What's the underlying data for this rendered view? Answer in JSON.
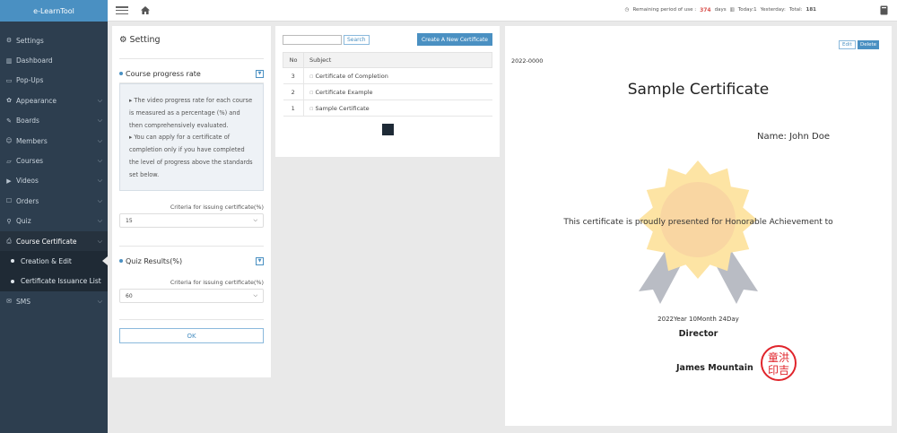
{
  "brand": "e-LearnTool",
  "menu": [
    {
      "icon": "⚙",
      "label": "Settings",
      "chevron": false
    },
    {
      "icon": "▥",
      "label": "Dashboard",
      "chevron": false
    },
    {
      "icon": "▭",
      "label": "Pop-Ups",
      "chevron": false
    },
    {
      "icon": "✿",
      "label": "Appearance",
      "chevron": true
    },
    {
      "icon": "✎",
      "label": "Boards",
      "chevron": true
    },
    {
      "icon": "☺",
      "label": "Members",
      "chevron": true
    },
    {
      "icon": "▱",
      "label": "Courses",
      "chevron": true
    },
    {
      "icon": "▶",
      "label": "Videos",
      "chevron": true
    },
    {
      "icon": "☐",
      "label": "Orders",
      "chevron": true
    },
    {
      "icon": "⚲",
      "label": "Quiz",
      "chevron": true
    },
    {
      "icon": "⎙",
      "label": "Course Certificate",
      "chevron": true
    },
    {
      "icon": "✉",
      "label": "SMS",
      "chevron": true
    }
  ],
  "submenu": [
    {
      "label": "Creation & Edit"
    },
    {
      "label": "Certificate Issuance List"
    }
  ],
  "topbar": {
    "remaining_label": "Remaining period of use :",
    "remaining_days": "374",
    "days_label": "days",
    "today": "Today:1",
    "yesterday": "Yesterday:",
    "total_label": "Total:",
    "total_value": "181"
  },
  "setting": {
    "title": "Setting",
    "course_progress_label": "Course progress rate",
    "info_line1": "▸ The video progress rate for each course is measured as a percentage (%) and then comprehensively evaluated.",
    "info_line2": "▸ You can apply for a certificate of completion only if you have completed the level of progress above the standards set below.",
    "criteria_label": "Criteria for issuing certificate(%)",
    "progress_value": "15",
    "quiz_label": "Quiz Results(%)",
    "quiz_criteria_label": "Criteria for issuing certificate(%)",
    "quiz_value": "60",
    "ok_label": "OK"
  },
  "list": {
    "search_placeholder": "",
    "search_label": "Search",
    "create_label": "Create A New Certificate",
    "col_no": "No",
    "col_subject": "Subject",
    "rows": [
      {
        "no": "3",
        "subject": "Certificate of Completion"
      },
      {
        "no": "2",
        "subject": "Certificate Example"
      },
      {
        "no": "1",
        "subject": "Sample Certificate"
      }
    ]
  },
  "preview": {
    "edit_label": "Edit",
    "delete_label": "Delete",
    "number": "2022-0000",
    "title": "Sample Certificate",
    "name": "Name: John Doe",
    "body": "This certificate is proudly presented for Honorable Achievement to",
    "date": "2022Year 10Month 24Day",
    "role": "Director",
    "signer": "James Mountain",
    "seal_chars": [
      "洪",
      "童",
      "吉",
      "印"
    ]
  },
  "colors": {
    "accent": "#4a90c2",
    "sidebar": "#2d3e4f",
    "rosette_outer": "#fde4a4",
    "rosette_inner": "#f9d6a2",
    "ribbon": "#b9bcc4",
    "seal": "#e0242b"
  }
}
